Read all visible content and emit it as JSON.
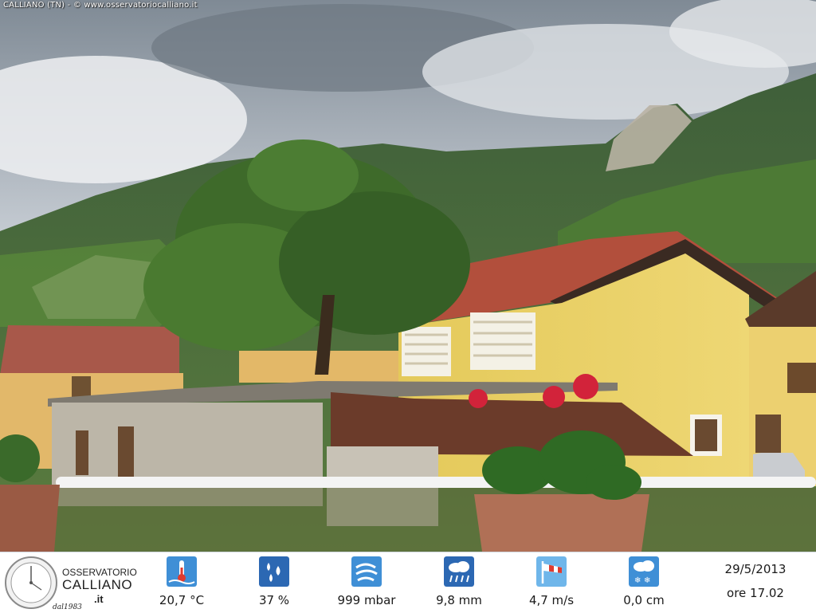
{
  "caption": "CALLIANO (TN) - © www.osservatoriocalliano.it",
  "brand": {
    "line1": "OSSERVATORIO",
    "line2": "CALLIANO",
    "line3": ".it",
    "since": "dal1983"
  },
  "readings": [
    {
      "icon": "thermometer-icon",
      "value": "20,7 °C"
    },
    {
      "icon": "humidity-drops-icon",
      "value": "37 %"
    },
    {
      "icon": "pressure-wind-icon",
      "value": "999 mbar"
    },
    {
      "icon": "rain-cloud-icon",
      "value": "9,8 mm"
    },
    {
      "icon": "windsock-icon",
      "value": "4,7 m/s"
    },
    {
      "icon": "snow-cloud-icon",
      "value": "0,0 cm"
    }
  ],
  "date": "29/5/2013",
  "time": "ore 17.02",
  "colors": {
    "icon_blue": "#2f6fb8",
    "bar_bg": "#ffffff"
  }
}
